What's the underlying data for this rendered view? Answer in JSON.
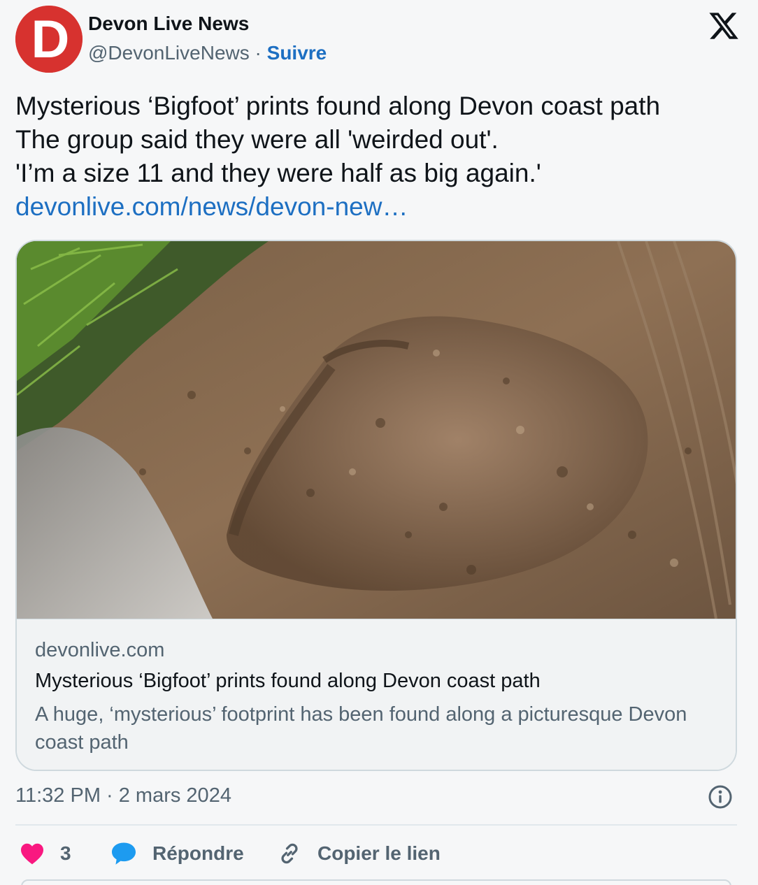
{
  "author": {
    "name": "Devon Live News",
    "handle": "@DevonLiveNews",
    "separator": "·",
    "follow_label": "Suivre",
    "avatar_letter": "D",
    "avatar_color": "#d7322f"
  },
  "tweet": {
    "lines": [
      "Mysterious ‘Bigfoot’ prints found along Devon coast path",
      "The group said they were all 'weirded out'.",
      "'I’m a size 11 and they were half as big again.'"
    ],
    "link_text": "devonlive.com/news/devon-new…",
    "link_color": "#1d6fc2"
  },
  "card": {
    "image_icon": "muddy-footprint-photo",
    "domain": "devonlive.com",
    "title": "Mysterious ‘Bigfoot’ prints found along Devon coast path",
    "description": "A huge, ‘mysterious’ footprint has been found along a picturesque Devon coast path"
  },
  "meta": {
    "timestamp": "11:32 PM · 2 mars 2024",
    "info_icon": "info-icon"
  },
  "actions": {
    "like_count": "3",
    "reply_label": "Répondre",
    "copy_label": "Copier le lien",
    "like_color": "#f91880",
    "reply_color": "#1d9bf0"
  }
}
